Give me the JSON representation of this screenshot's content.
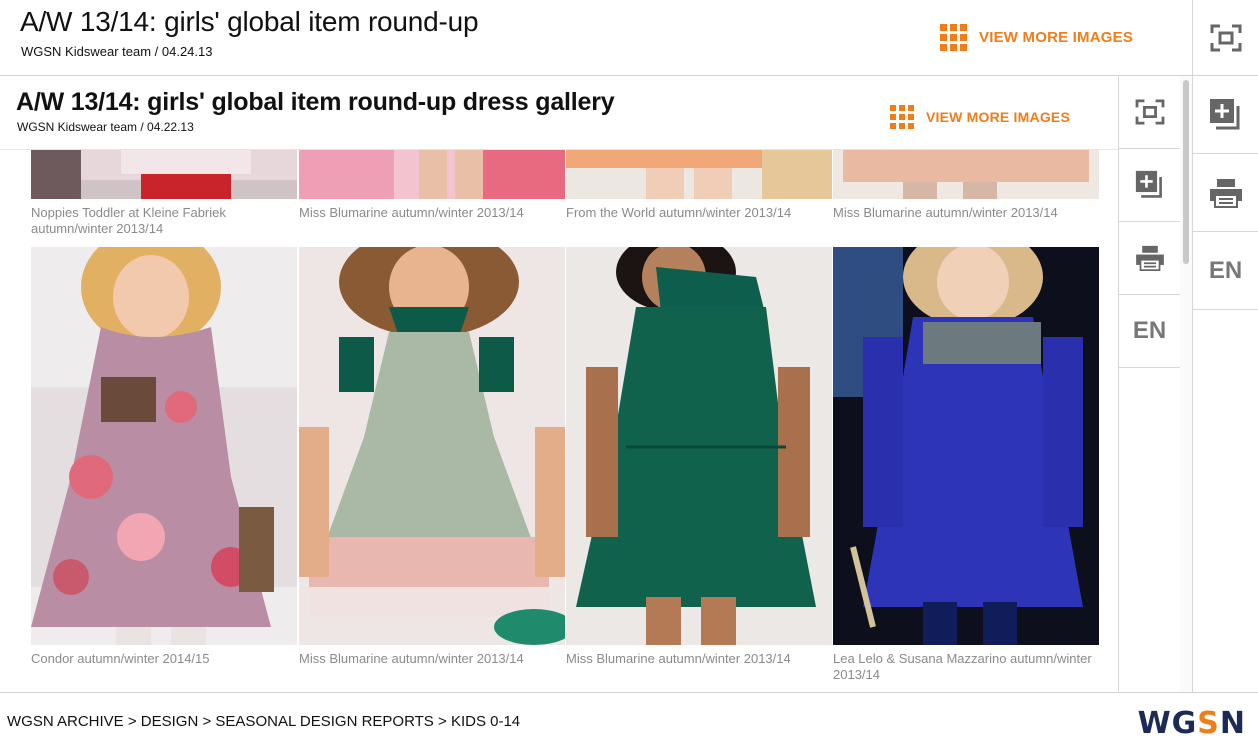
{
  "outer": {
    "title": "A/W 13/14: girls' global item round-up",
    "byline": "WGSN Kidswear team / 04.24.13",
    "view_more": "VIEW MORE IMAGES"
  },
  "inner": {
    "title": "A/W 13/14: girls' global item round-up dress gallery",
    "byline": "WGSN Kidswear team / 04.22.13",
    "view_more": "VIEW MORE IMAGES"
  },
  "sidebar": {
    "language": "EN",
    "icons": [
      "fullscreen-icon",
      "add-to-board-icon",
      "print-icon"
    ]
  },
  "gallery": {
    "row1": [
      {
        "caption": "Noppies Toddler at Kleine Fabriek autumn/winter 2013/14"
      },
      {
        "caption": "Miss Blumarine autumn/winter 2013/14"
      },
      {
        "caption": "From the World autumn/winter 2013/14"
      },
      {
        "caption": "Miss Blumarine autumn/winter 2013/14"
      }
    ],
    "row2": [
      {
        "caption": "Condor autumn/winter 2014/15"
      },
      {
        "caption": "Miss Blumarine autumn/winter 2013/14"
      },
      {
        "caption": "Miss Blumarine autumn/winter 2013/14"
      },
      {
        "caption": "Lea Lelo & Susana Mazzarino autumn/winter 2013/14"
      }
    ]
  },
  "footer": {
    "breadcrumb": [
      {
        "label": "WGSN ARCHIVE"
      },
      {
        "label": "DESIGN"
      },
      {
        "label": "SEASONAL DESIGN REPORTS"
      },
      {
        "label": "KIDS 0-14"
      }
    ],
    "separator": " > ",
    "logo_part1": "WG",
    "logo_s": "S",
    "logo_part2": "N"
  },
  "colors": {
    "accent": "#f07d1a",
    "brand": "#1c2b55"
  }
}
